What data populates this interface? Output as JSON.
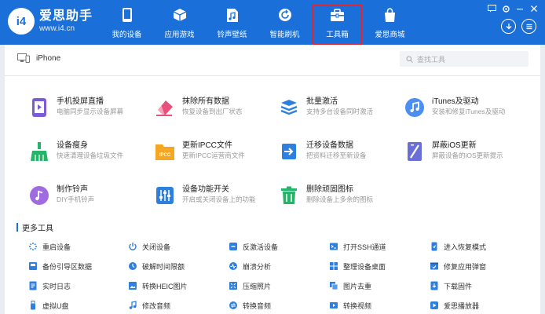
{
  "app": {
    "logo_text": "i4",
    "name": "爱思助手",
    "url": "www.i4.cn"
  },
  "nav": [
    {
      "label": "我的设备",
      "icon": "phone-icon"
    },
    {
      "label": "应用游戏",
      "icon": "cube-icon"
    },
    {
      "label": "铃声壁纸",
      "icon": "music-file-icon"
    },
    {
      "label": "智能刷机",
      "icon": "refresh-icon"
    },
    {
      "label": "工具箱",
      "icon": "toolbox-icon",
      "active": true
    },
    {
      "label": "爱思商城",
      "icon": "shopping-bag-icon"
    }
  ],
  "device": {
    "name": "iPhone"
  },
  "search": {
    "placeholder": "查找工具"
  },
  "tools": [
    {
      "title": "手机投屏直播",
      "desc": "电脑同步显示设备屏幕",
      "icon": "screen-mirror-icon",
      "color": "#7b5cd6"
    },
    {
      "title": "抹除所有数据",
      "desc": "恢复设备到出厂状态",
      "icon": "eraser-icon",
      "color": "#e9507a"
    },
    {
      "title": "批量激活",
      "desc": "支持多台设备同时激活",
      "icon": "batch-activate-icon",
      "color": "#2d7fe0"
    },
    {
      "title": "iTunes及驱动",
      "desc": "安装和修复iTunes及驱动",
      "icon": "music-note-icon",
      "color": "#4c8ff2"
    },
    {
      "title": "设备瘦身",
      "desc": "快速清理设备垃圾文件",
      "icon": "broom-icon",
      "color": "#26b36a"
    },
    {
      "title": "更新IPCC文件",
      "desc": "更新IPCC运营商文件",
      "icon": "ipcc-folder-icon",
      "color": "#f5a623"
    },
    {
      "title": "迁移设备数据",
      "desc": "把资料迁移至新设备",
      "icon": "migrate-icon",
      "color": "#2d7fe0"
    },
    {
      "title": "屏蔽iOS更新",
      "desc": "屏蔽设备的iOS更新提示",
      "icon": "block-update-icon",
      "color": "#6a6fd8"
    },
    {
      "title": "制作铃声",
      "desc": "DIY手机铃声",
      "icon": "ringtone-icon",
      "color": "#a06be0"
    },
    {
      "title": "设备功能开关",
      "desc": "开启或关闭设备上的功能",
      "icon": "switches-icon",
      "color": "#2d7fe0"
    },
    {
      "title": "删除顽固图标",
      "desc": "删除设备上多余的图标",
      "icon": "trash-icon",
      "color": "#26b36a"
    }
  ],
  "more_tools": {
    "title": "更多工具",
    "items": [
      {
        "label": "重启设备",
        "icon": "restart-icon"
      },
      {
        "label": "关闭设备",
        "icon": "power-icon"
      },
      {
        "label": "反激活设备",
        "icon": "deactivate-icon"
      },
      {
        "label": "打开SSH通道",
        "icon": "ssh-icon"
      },
      {
        "label": "进入恢复模式",
        "icon": "recovery-mode-icon"
      },
      {
        "label": "备份引导区数据",
        "icon": "backup-boot-icon"
      },
      {
        "label": "破解时间限额",
        "icon": "time-limit-icon"
      },
      {
        "label": "崩溃分析",
        "icon": "crash-analysis-icon"
      },
      {
        "label": "整理设备桌面",
        "icon": "arrange-desktop-icon"
      },
      {
        "label": "修复应用弹窗",
        "icon": "fix-popup-icon"
      },
      {
        "label": "实时日志",
        "icon": "realtime-log-icon"
      },
      {
        "label": "转换HEIC图片",
        "icon": "heic-convert-icon"
      },
      {
        "label": "压缩照片",
        "icon": "compress-photo-icon"
      },
      {
        "label": "图片去重",
        "icon": "dedupe-image-icon"
      },
      {
        "label": "下载固件",
        "icon": "download-firmware-icon"
      },
      {
        "label": "虚拟U盘",
        "icon": "virtual-usb-icon"
      },
      {
        "label": "修改音频",
        "icon": "edit-audio-icon"
      },
      {
        "label": "转换音频",
        "icon": "convert-audio-icon"
      },
      {
        "label": "转换视频",
        "icon": "convert-video-icon"
      },
      {
        "label": "爱思播放器",
        "icon": "player-icon"
      }
    ]
  },
  "colors": {
    "titlebar": "#1a6fd8",
    "accent": "#1a6fd8",
    "active_outline": "#e0262e",
    "more_icon": "#2d7fe0"
  }
}
